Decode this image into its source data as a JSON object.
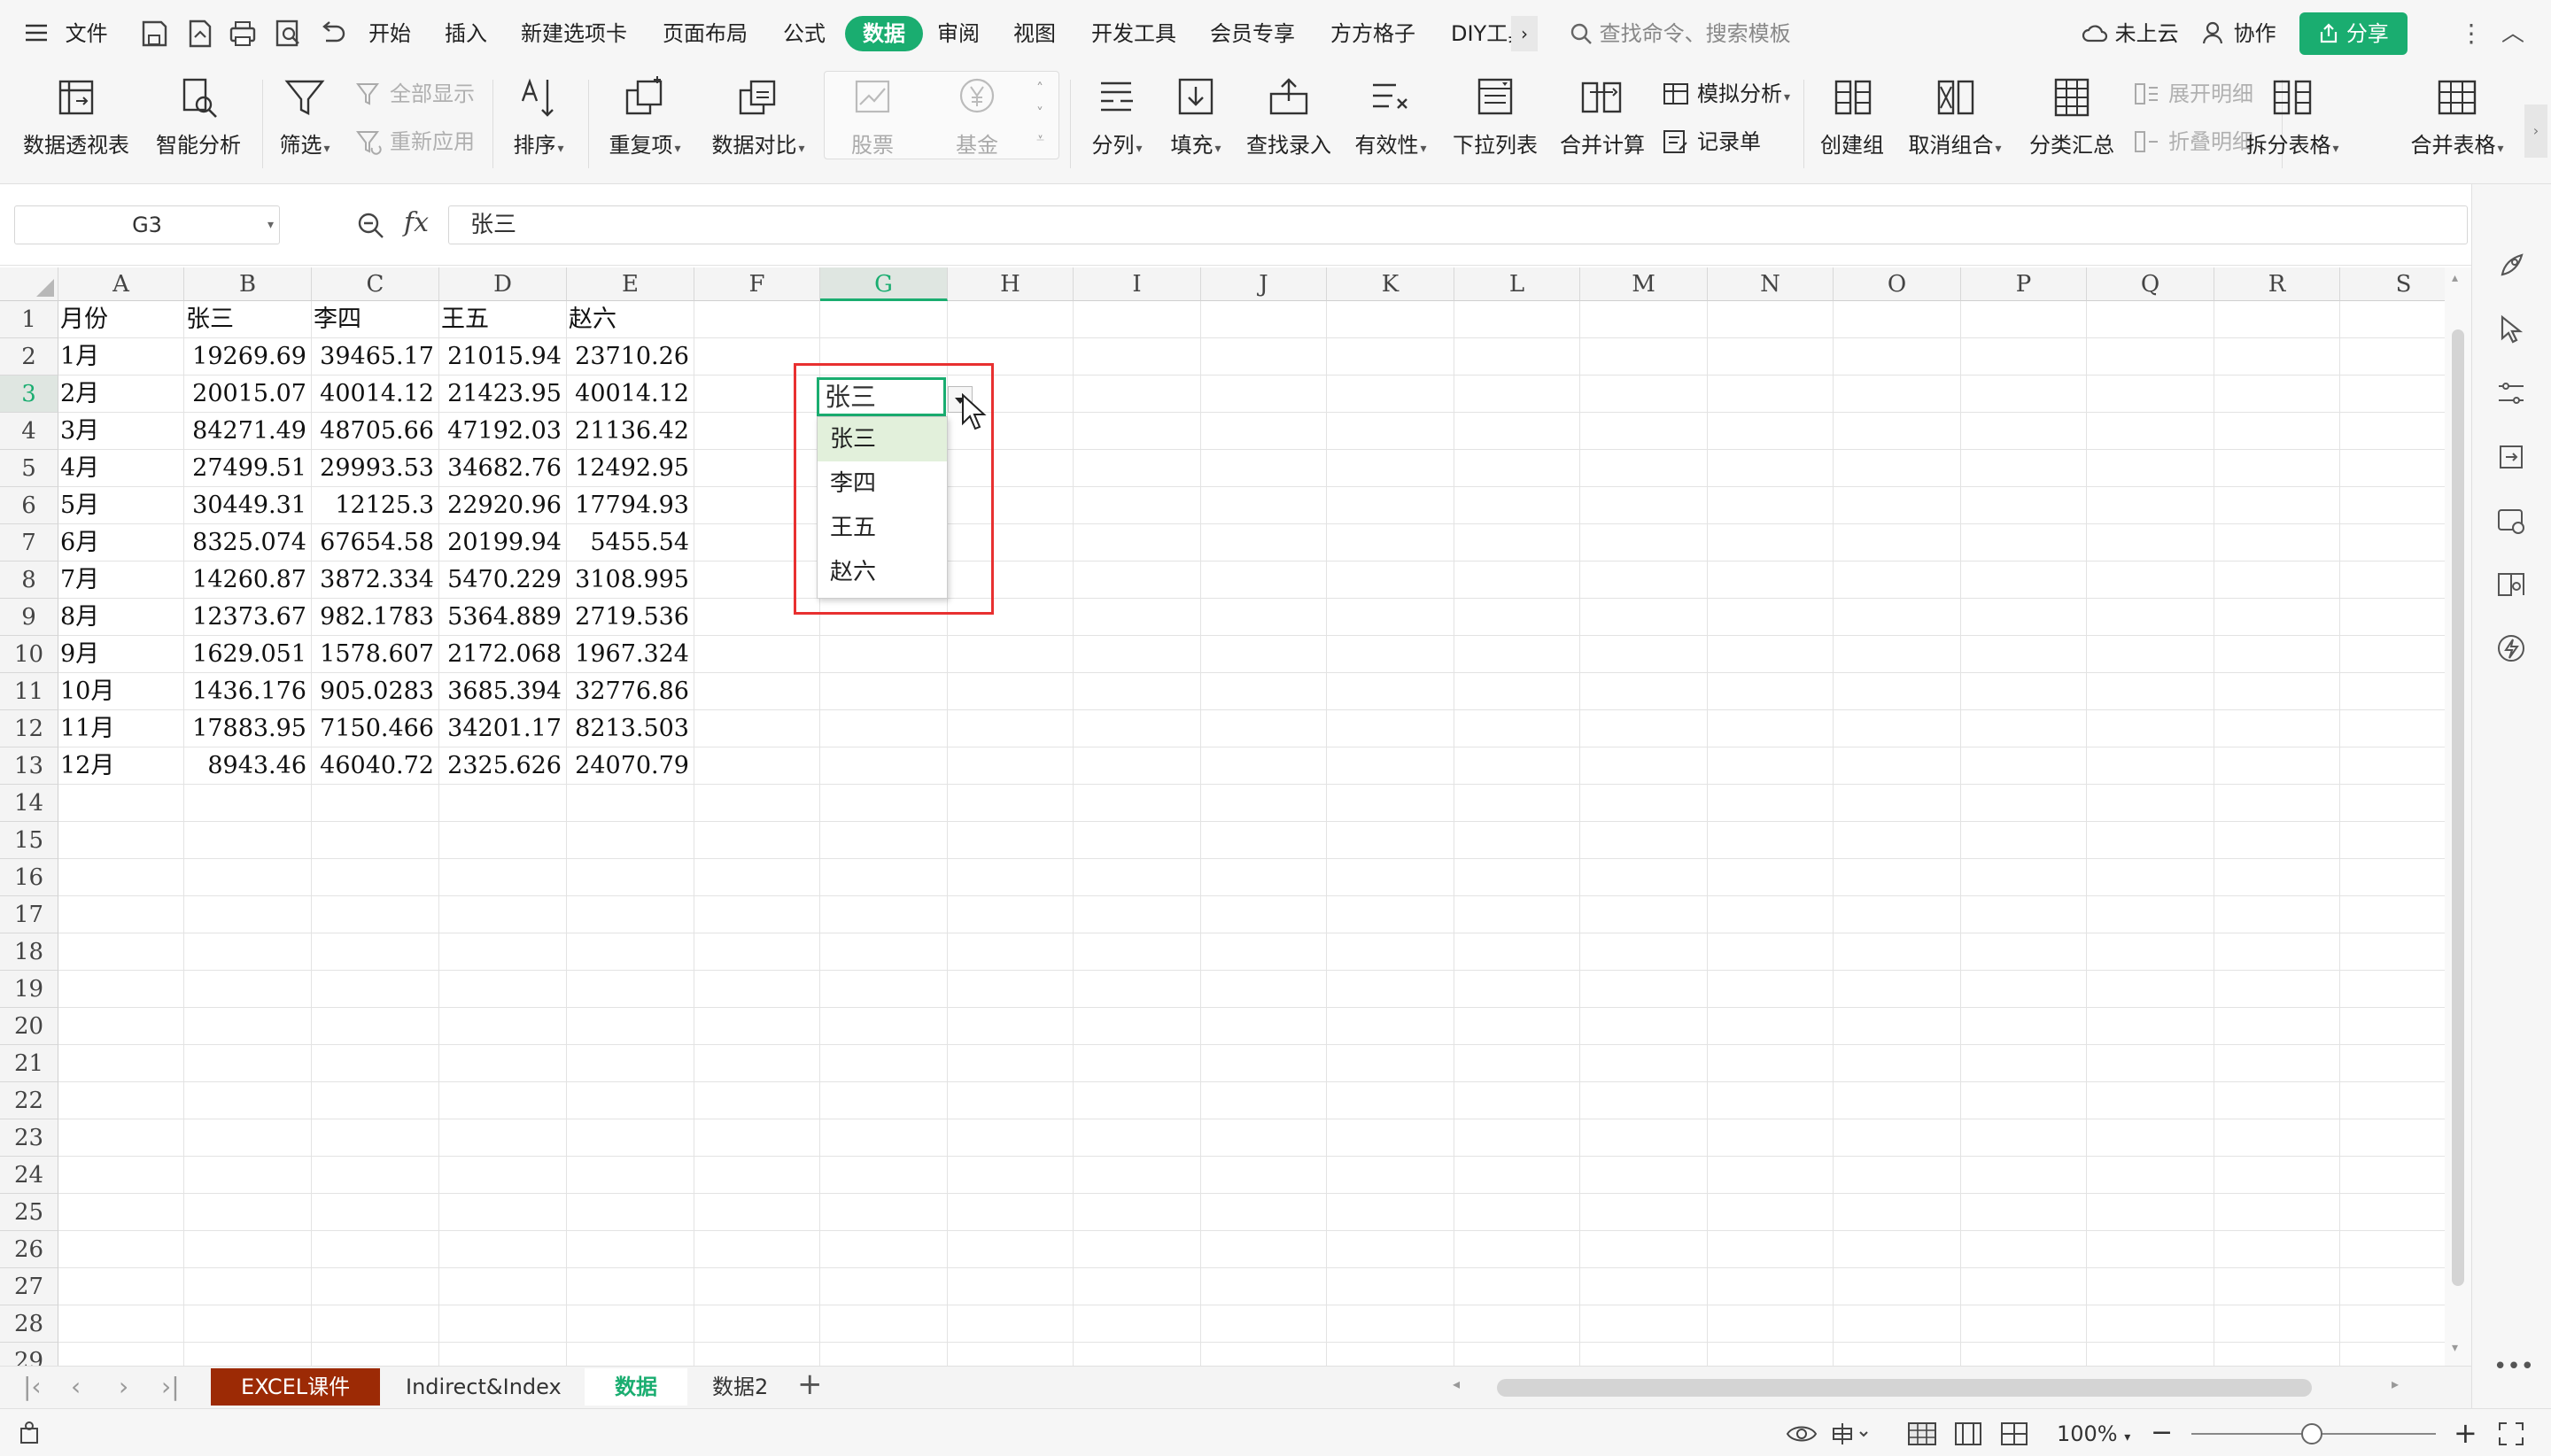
{
  "menubar": {
    "file": "文件",
    "items": [
      "开始",
      "插入",
      "新建选项卡",
      "页面布局",
      "公式",
      "数据",
      "审阅",
      "视图",
      "开发工具",
      "会员专享",
      "方方格子",
      "DIY工具"
    ],
    "search_placeholder": "查找命令、搜索模板",
    "cloud": "未上云",
    "collab": "协作",
    "share": "分享"
  },
  "ribbon": {
    "pivot": "数据透视表",
    "smart": "智能分析",
    "filter": "筛选",
    "show_all": "全部显示",
    "reapply": "重新应用",
    "sort": "排序",
    "dup": "重复项",
    "compare": "数据对比",
    "stock": "股票",
    "fund": "基金",
    "split": "分列",
    "fill": "填充",
    "lookup": "查找录入",
    "valid": "有效性",
    "dropdown": "下拉列表",
    "merge_calc": "合并计算",
    "whatif": "模拟分析",
    "record": "记录单",
    "group": "创建组",
    "ungroup": "取消组合",
    "subtotal": "分类汇总",
    "expand": "展开明细",
    "collapse": "折叠明细",
    "split_table": "拆分表格",
    "merge_table": "合并表格"
  },
  "formula_bar": {
    "name_box": "G3",
    "fx": "fx",
    "value": "张三"
  },
  "grid": {
    "columns": [
      "A",
      "B",
      "C",
      "D",
      "E",
      "F",
      "G",
      "H",
      "I",
      "J",
      "K",
      "L",
      "M",
      "N",
      "O",
      "P",
      "Q",
      "R",
      "S"
    ],
    "rows": [
      "1",
      "2",
      "3",
      "4",
      "5",
      "6",
      "7",
      "8",
      "9",
      "10",
      "11",
      "12",
      "13",
      "14",
      "15",
      "16",
      "17",
      "18",
      "19",
      "20",
      "21",
      "22",
      "23",
      "24",
      "25",
      "26",
      "27",
      "28",
      "29"
    ],
    "headers": [
      "月份",
      "张三",
      "李四",
      "王五",
      "赵六"
    ],
    "data": [
      [
        "1月",
        "19269.69",
        "39465.17",
        "21015.94",
        "23710.26"
      ],
      [
        "2月",
        "20015.07",
        "40014.12",
        "21423.95",
        "40014.12"
      ],
      [
        "3月",
        "84271.49",
        "48705.66",
        "47192.03",
        "21136.42"
      ],
      [
        "4月",
        "27499.51",
        "29993.53",
        "34682.76",
        "12492.95"
      ],
      [
        "5月",
        "30449.31",
        "12125.3",
        "22920.96",
        "17794.93"
      ],
      [
        "6月",
        "8325.074",
        "67654.58",
        "20199.94",
        "5455.54"
      ],
      [
        "7月",
        "14260.87",
        "3872.334",
        "5470.229",
        "3108.995"
      ],
      [
        "8月",
        "12373.67",
        "982.1783",
        "5364.889",
        "2719.536"
      ],
      [
        "9月",
        "1629.051",
        "1578.607",
        "2172.068",
        "1967.324"
      ],
      [
        "10月",
        "1436.176",
        "905.0283",
        "3685.394",
        "32776.86"
      ],
      [
        "11月",
        "17883.95",
        "7150.466",
        "34201.17",
        "8213.503"
      ],
      [
        "12月",
        "8943.46",
        "46040.72",
        "2325.626",
        "24070.79"
      ]
    ]
  },
  "dropdown": {
    "active_value": "张三",
    "options": [
      "张三",
      "李四",
      "王五",
      "赵六"
    ]
  },
  "sheet_tabs": [
    "EXCEL课件",
    "Indirect&Index",
    "数据",
    "数据2"
  ],
  "status": {
    "zoom": "100%"
  },
  "colors": {
    "accent": "#1aad70",
    "highlight_frame": "#e83030",
    "tab_red": "#9c2a05"
  }
}
